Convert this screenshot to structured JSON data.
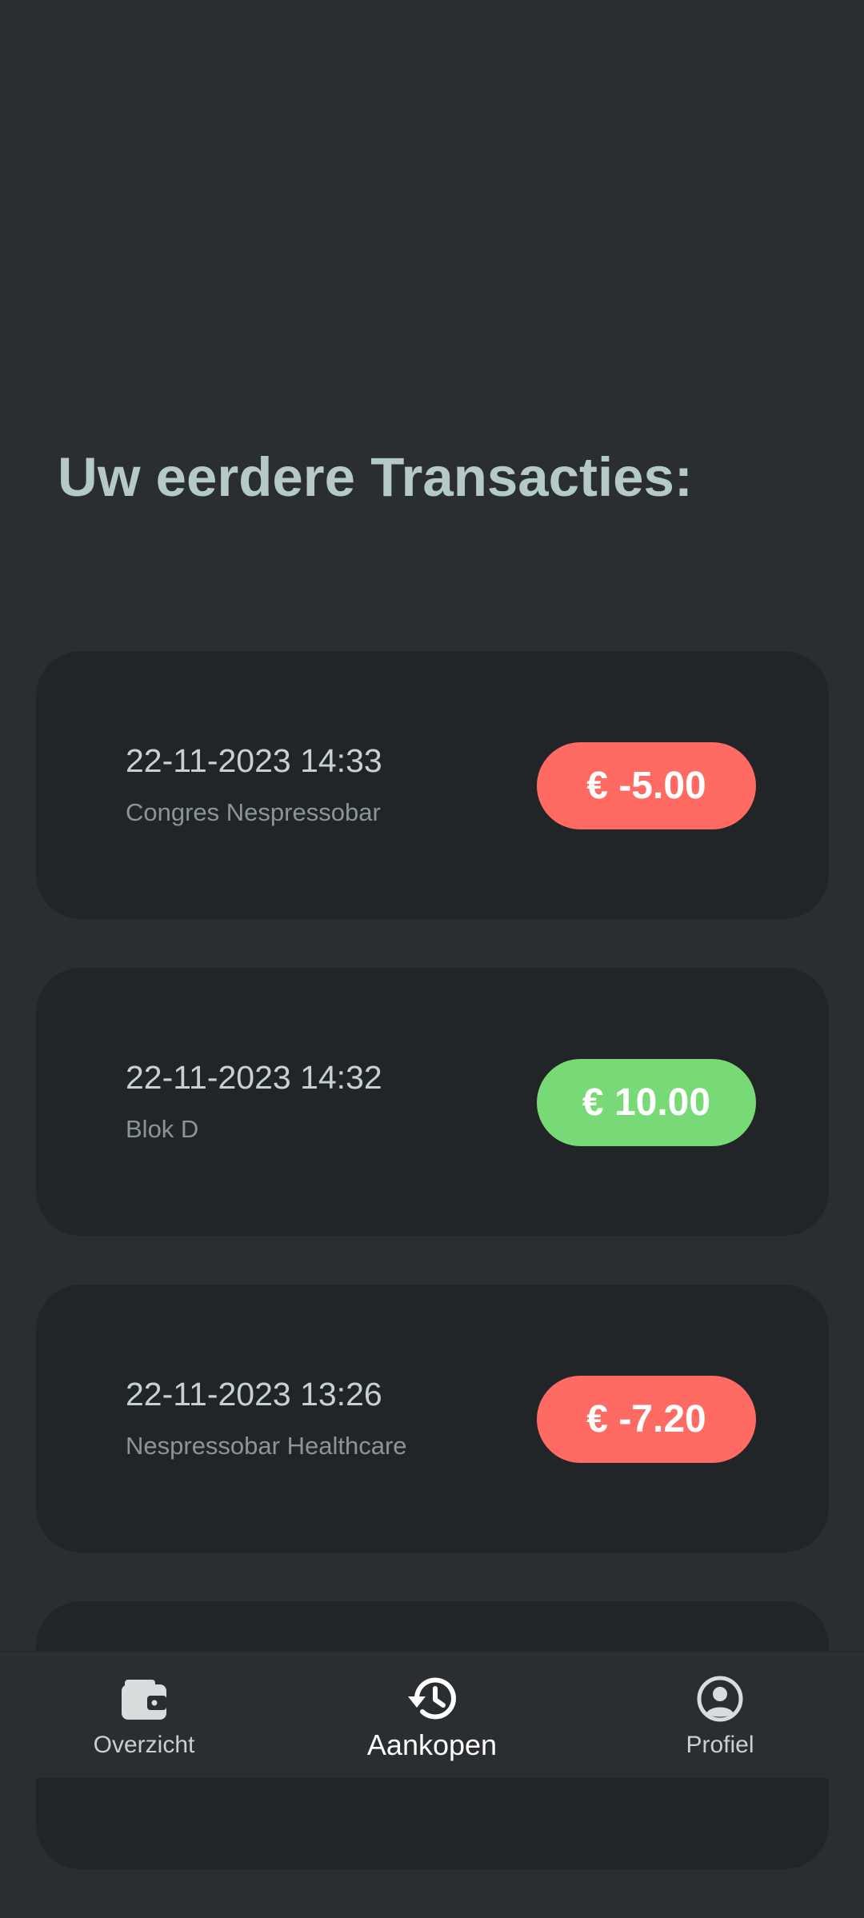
{
  "header": {
    "title": "Uw eerdere Transacties:"
  },
  "transactions": [
    {
      "date": "22-11-2023 14:33",
      "place": "Congres Nespressobar",
      "amount": "€ -5.00",
      "type": "negative"
    },
    {
      "date": "22-11-2023 14:32",
      "place": "Blok D",
      "amount": "€ 10.00",
      "type": "positive"
    },
    {
      "date": "22-11-2023 13:26",
      "place": "Nespressobar Healthcare",
      "amount": "€ -7.20",
      "type": "negative"
    }
  ],
  "bottom_nav": {
    "items": [
      {
        "label": "Overzicht",
        "icon": "wallet-icon"
      },
      {
        "label": "Aankopen",
        "icon": "history-icon",
        "active": true
      },
      {
        "label": "Profiel",
        "icon": "profile-icon"
      }
    ]
  },
  "colors": {
    "background": "#2b2e30",
    "card": "#222527",
    "negative": "#ff6b63",
    "positive": "#78d977",
    "title": "#b6c9c9"
  }
}
